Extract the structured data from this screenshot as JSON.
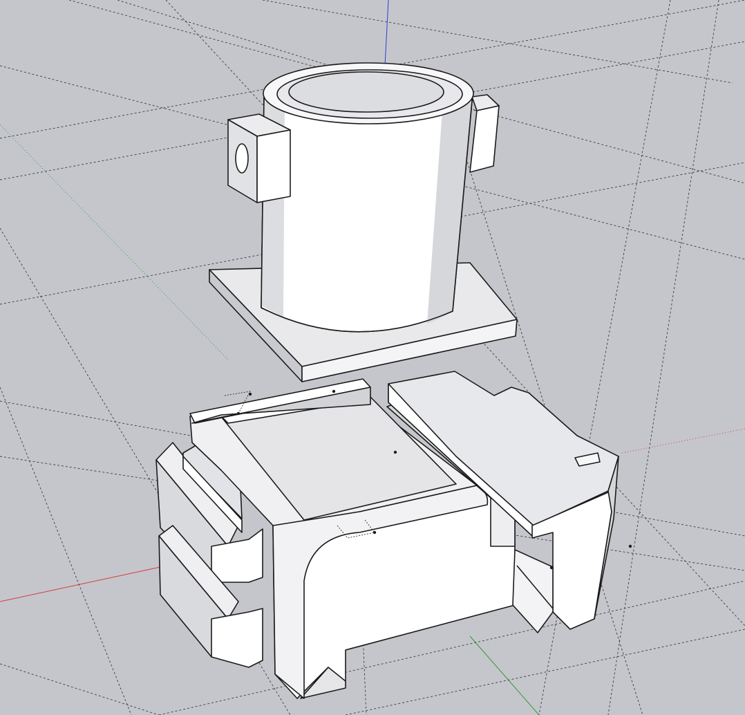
{
  "viewport": {
    "background": "#c5c6cb",
    "axis_colors": {
      "red": "#d23c3c",
      "green": "#2e9a3a",
      "blue": "#2b3fd0"
    },
    "face_colors": {
      "light": "#ffffff",
      "mid": "#e6e6e9",
      "dark": "#cfd0d4",
      "line": "#1a1a1a"
    }
  },
  "model": {
    "parts": [
      "cylinder-housing",
      "square-base-plate",
      "lower-mount-block",
      "right-clamp-rail"
    ]
  }
}
